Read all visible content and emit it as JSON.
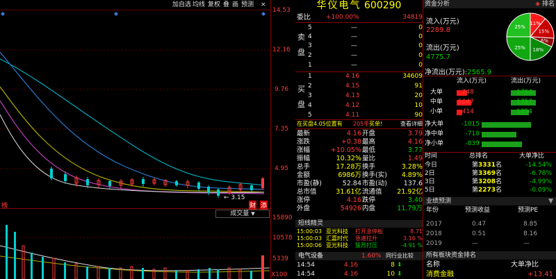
{
  "toolbar": {
    "items": [
      "加自选",
      "均线",
      "复权",
      "叠",
      "画",
      "预测"
    ],
    "close": "×"
  },
  "price_axis": [
    "14.53",
    "12.16",
    "9.76",
    "7.35",
    "4.95"
  ],
  "chart": {
    "low_label": "3.15",
    "left_tag": "榜",
    "badge_cai": "财",
    "badge_fa": "添",
    "volume_tab": "成交量",
    "volume_axis": [
      "15890",
      "10578",
      "5339",
      "X100"
    ]
  },
  "stock": {
    "title": "华仪电气",
    "code": "600290"
  },
  "weibi": {
    "label": "委比",
    "value": "+100.00%",
    "diff": "34819"
  },
  "sell_side": {
    "label": "卖盘",
    "rows": [
      {
        "lvl": "5",
        "price": "—",
        "vol": "0"
      },
      {
        "lvl": "4",
        "price": "—",
        "vol": "0"
      },
      {
        "lvl": "3",
        "price": "—",
        "vol": "0"
      },
      {
        "lvl": "2",
        "price": "—",
        "vol": "0"
      },
      {
        "lvl": "1",
        "price": "—",
        "vol": "0"
      }
    ]
  },
  "buy_side": {
    "label": "买盘",
    "rows": [
      {
        "lvl": "1",
        "price": "4.16",
        "vol": "34609"
      },
      {
        "lvl": "2",
        "price": "4.15",
        "vol": "91"
      },
      {
        "lvl": "3",
        "price": "4.13",
        "vol": "20"
      },
      {
        "lvl": "4",
        "price": "4.12",
        "vol": "10"
      },
      {
        "lvl": "5",
        "price": "4.11",
        "vol": "90"
      }
    ]
  },
  "notice": {
    "text": "在买盘4.05位置有",
    "num": "205手",
    "tag": "买单!",
    "link": "查看详细"
  },
  "quote_rows": [
    {
      "l1": "最新",
      "v1": "4.16",
      "l2": "开盘",
      "v2": "3.79"
    },
    {
      "l1": "涨跌",
      "v1": "+0.38",
      "l2": "最高",
      "v2": "4.16"
    },
    {
      "l1": "涨幅",
      "v1": "+10.05%",
      "l2": "最低",
      "v2": "3.77"
    },
    {
      "l1": "振幅",
      "v1": "10.32%",
      "l2": "量比",
      "v2": "1.49"
    },
    {
      "l1": "总手",
      "v1": "17.28万",
      "l2": "换手",
      "v2": "3.28%"
    },
    {
      "l1": "金额",
      "v1": "6986万",
      "l2": "换手(实)",
      "v2": "4.89%"
    },
    {
      "l1": "市盈(静)",
      "v1": "52.84",
      "l2": "市盈(动)",
      "v2": "137.6"
    },
    {
      "l1": "总市值",
      "v1": "31.61亿",
      "l2": "流通值",
      "v2": "21.92亿"
    },
    {
      "l1": "涨停",
      "v1": "4.16",
      "l2": "跌停",
      "v2": "3.40"
    },
    {
      "l1": "外盘",
      "v1": "54926",
      "l2": "内盘",
      "v2": "11.79万"
    }
  ],
  "shortline": {
    "title": "短线精灵",
    "rows": [
      {
        "time": "15:00:03",
        "name": "亚光科技",
        "event": "打开涨停板",
        "val": "8.71"
      },
      {
        "time": "15:00:03",
        "name": "汇嘉时代",
        "event": "急速拉升",
        "val": "3.16 %"
      },
      {
        "time": "15:00:06",
        "name": "亚光科技",
        "event": "猛烈打压",
        "val": "-4.91 %"
      }
    ]
  },
  "industry": {
    "name": "电气设备",
    "pct": "1.60%",
    "compare": "同行业比较"
  },
  "ticks": [
    {
      "time": "14:54",
      "price": "4.16",
      "vol": "8"
    },
    {
      "time": "14:54",
      "price": "4.16",
      "vol": "10"
    }
  ],
  "fund": {
    "tab": "资金分析",
    "rank": "排名",
    "inflow_label": "流入(万元)",
    "inflow_value": "2289.8",
    "outflow_label": "流出(万元)",
    "outflow_value": "4775.7",
    "net_label": "净流出(万元):",
    "net_value": "2565.9",
    "pie": {
      "slices": [
        {
          "label": "11%",
          "value": 11,
          "color": "#ff1a1a"
        },
        {
          "label": "15%",
          "value": 15,
          "color": "#c80000"
        },
        {
          "label": "6%",
          "value": 6,
          "color": "#8a0000"
        },
        {
          "label": "18%",
          "value": 18,
          "color": "#0a8a0a"
        },
        {
          "label": "25%",
          "value": 25,
          "color": "#12a812"
        },
        {
          "label": "25%",
          "value": 25,
          "color": "#20c020"
        }
      ]
    },
    "col_in": "流入(万元)",
    "col_out": "流出(万元)",
    "orders": [
      {
        "name": "大单",
        "in": "748",
        "in_frac": 0.25,
        "out": "1764",
        "out_frac": 0.6
      },
      {
        "name": "中单",
        "in": "1047",
        "in_frac": 0.35,
        "out": "1757",
        "out_frac": 0.6
      },
      {
        "name": "小单",
        "in": "414",
        "in_frac": 0.14,
        "out": "1254",
        "out_frac": 0.43
      }
    ],
    "net": [
      {
        "name": "净大单",
        "value": "-1015",
        "frac": 0.82
      },
      {
        "name": "净中单",
        "value": "-710",
        "frac": 0.58
      },
      {
        "name": "净小单",
        "value": "-839",
        "frac": 0.68
      }
    ]
  },
  "ranking": {
    "headers": [
      "时间",
      "总排名",
      "大单净比"
    ],
    "rows": [
      {
        "t": "今日",
        "rank": "3331",
        "pct": "-14.54%"
      },
      {
        "t": "2日",
        "rank": "3369",
        "pct": "-6.78%"
      },
      {
        "t": "3日",
        "rank": "3208",
        "pct": "-4.99%"
      },
      {
        "t": "5日",
        "rank": "2273",
        "pct": "-0.09%"
      }
    ],
    "prefix": "第",
    "suffix": "名"
  },
  "forecast": {
    "title": "业绩预测",
    "headers": [
      "年份",
      "预测收益",
      "预测PE"
    ],
    "rows": [
      {
        "y": "2017",
        "eps": "0.47",
        "pe": "8.85"
      },
      {
        "y": "2018",
        "eps": "0.51",
        "pe": "8.16"
      },
      {
        "y": "2019",
        "eps": "—",
        "pe": "—"
      }
    ]
  },
  "sector": {
    "title": "所有板块资金排名",
    "headers": [
      "名称",
      "大单净比"
    ],
    "rows": [
      {
        "name": "消费金融",
        "pct": "+13.41"
      }
    ]
  }
}
